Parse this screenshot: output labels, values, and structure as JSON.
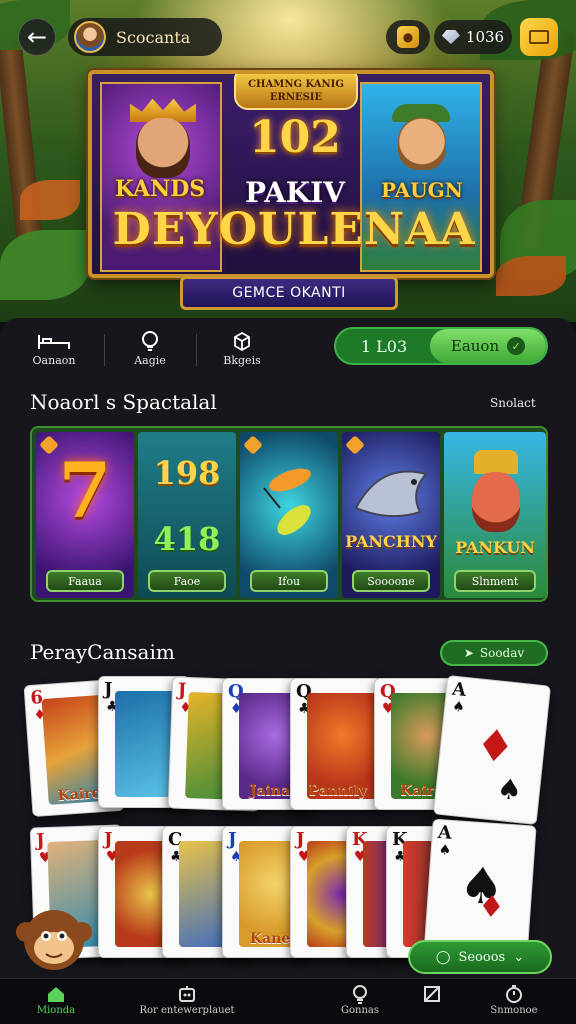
{
  "header": {
    "username": "Scocanta",
    "currency_value": "1036",
    "icons": [
      "back-arrow-icon",
      "avatar",
      "coin-icon",
      "gem-icon",
      "screen-icon"
    ]
  },
  "banner": {
    "header_text": "CHAMNG KANIG ERNESIE",
    "number": "102",
    "left_word": "KANDS",
    "mid_word": "PAKIV",
    "right_word": "PAUGN",
    "big_title": "DEYOULENAA",
    "badge": "GEMCE OKANTI"
  },
  "toolbar": {
    "items": [
      {
        "label": "Oanaon",
        "icon": "bed-icon"
      },
      {
        "label": "Aagie",
        "icon": "bulb-icon"
      },
      {
        "label": "Bkgeis",
        "icon": "box-icon"
      }
    ],
    "level_value": "1 L03",
    "level_button": "Eauon"
  },
  "section_games": {
    "title": "Noaorl s Spactalal",
    "link": "Snolact",
    "tiles": [
      {
        "label": "Faaua",
        "art": "7"
      },
      {
        "label": "Faoe",
        "art_top": "198",
        "art_bottom": "418"
      },
      {
        "label": "Ifou",
        "art": ""
      },
      {
        "label": "Soooone",
        "art": "PANCHNY"
      },
      {
        "label": "Slnment",
        "art": "PANKUN"
      }
    ]
  },
  "section_cards": {
    "title": "PerayCansaim",
    "badge": "Soodav",
    "row1": [
      {
        "rank": "6",
        "label": "Kairo"
      },
      {
        "rank": "J",
        "label": ""
      },
      {
        "rank": "J",
        "label": ""
      },
      {
        "rank": "Q",
        "label": "Jaina"
      },
      {
        "rank": "Q",
        "label": "Pannily"
      },
      {
        "rank": "Q",
        "label": "Kairo"
      },
      {
        "rank": "A",
        "label": ""
      }
    ],
    "row2": [
      {
        "rank": "J",
        "label": ""
      },
      {
        "rank": "J",
        "label": ""
      },
      {
        "rank": "C",
        "label": ""
      },
      {
        "rank": "J",
        "label": "Kane"
      },
      {
        "rank": "J",
        "label": ""
      },
      {
        "rank": "K",
        "label": ""
      },
      {
        "rank": "K",
        "label": ""
      },
      {
        "rank": "A",
        "label": ""
      }
    ],
    "play_badge": "Seooos"
  },
  "bottom_nav": [
    {
      "label": "Mionda",
      "icon": "home-icon",
      "active": true
    },
    {
      "label": "Ror entewerplauet",
      "icon": "robot-icon",
      "active": false
    },
    {
      "label": "Gonnas",
      "icon": "bulb-icon",
      "active": false
    },
    {
      "label": "",
      "icon": "square-icon",
      "active": false
    },
    {
      "label": "Snmonoe",
      "icon": "timer-icon",
      "active": false
    }
  ],
  "colors": {
    "accent_green": "#3fb34a",
    "gold": "#c9932a",
    "panel": "#16161c"
  }
}
